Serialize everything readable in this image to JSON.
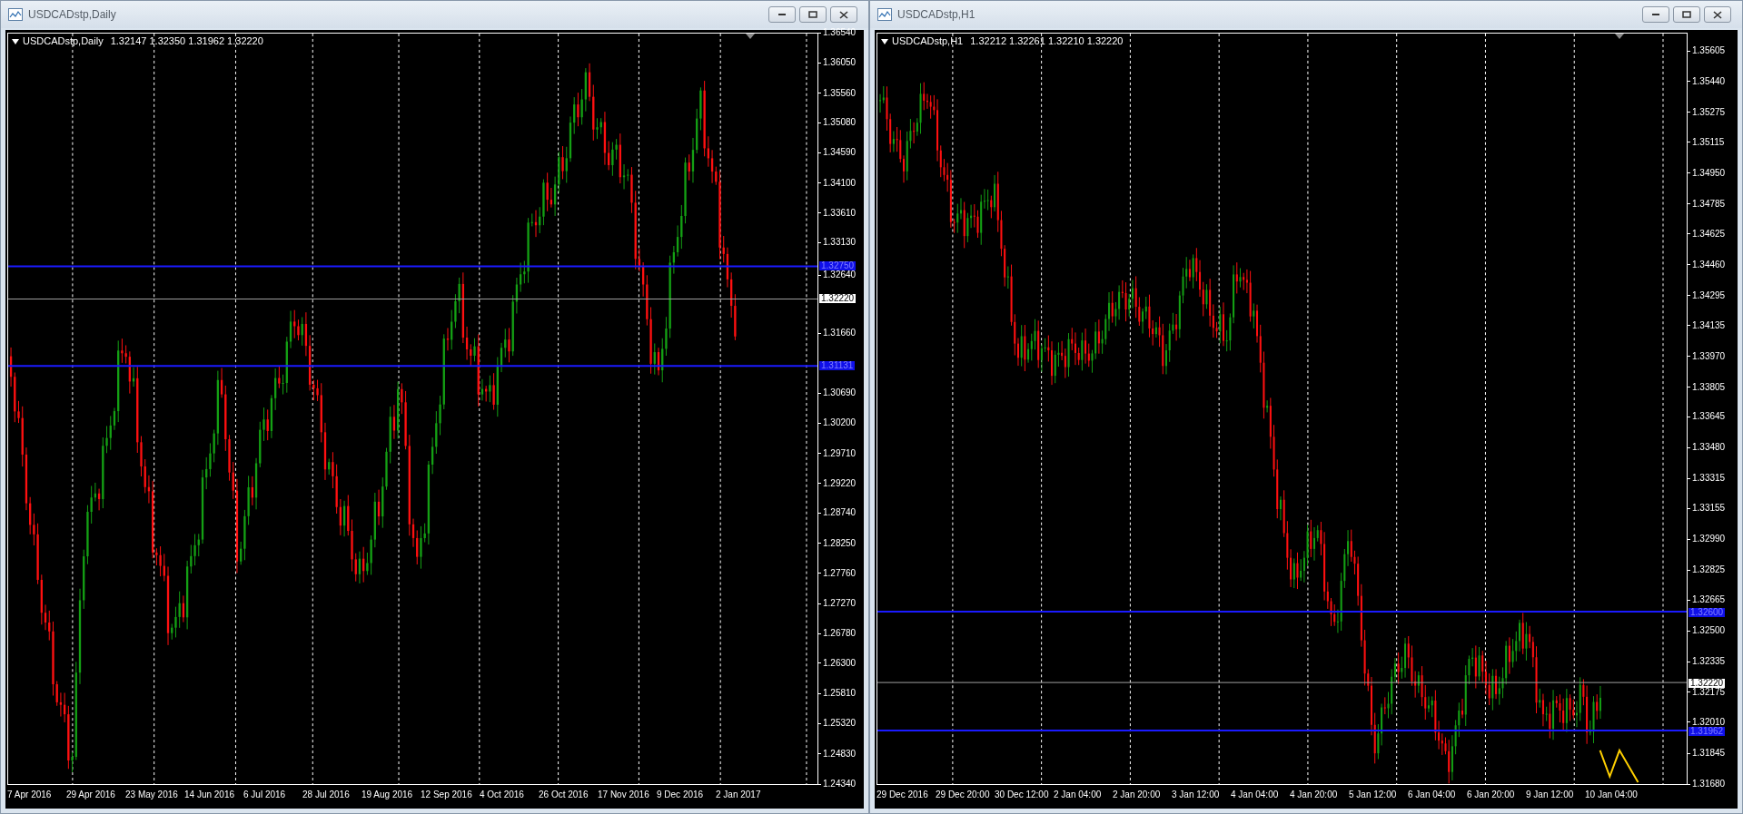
{
  "windows": [
    {
      "title": "USDCADstp,Daily",
      "chart": {
        "symbol": "USDCADstp,Daily",
        "ohlc": "1.32147 1.32350 1.31962 1.32220",
        "price_ticks": [
          "1.36540",
          "1.36050",
          "1.35560",
          "1.35080",
          "1.34590",
          "1.34100",
          "1.33610",
          "1.33130",
          "1.32640",
          "1.31660",
          "1.30690",
          "1.30200",
          "1.29710",
          "1.29220",
          "1.28740",
          "1.28250",
          "1.27760",
          "1.27270",
          "1.26780",
          "1.26300",
          "1.25810",
          "1.25320",
          "1.24830",
          "1.24340"
        ],
        "time_ticks": [
          "7 Apr 2016",
          "29 Apr 2016",
          "23 May 2016",
          "14 Jun 2016",
          "6 Jul 2016",
          "28 Jul 2016",
          "19 Aug 2016",
          "12 Sep 2016",
          "4 Oct 2016",
          "26 Oct 2016",
          "17 Nov 2016",
          "9 Dec 2016",
          "2 Jan 2017"
        ],
        "levels": [
          {
            "label": "1.32750"
          },
          {
            "label": "1.31131"
          }
        ],
        "current_price": "1.32220"
      }
    },
    {
      "title": "USDCADstp,H1",
      "chart": {
        "symbol": "USDCADstp,H1",
        "ohlc": "1.32212 1.32261 1.32210 1.32220",
        "price_ticks": [
          "1.35605",
          "1.35440",
          "1.35275",
          "1.35115",
          "1.34950",
          "1.34785",
          "1.34625",
          "1.34460",
          "1.34295",
          "1.34135",
          "1.33970",
          "1.33805",
          "1.33645",
          "1.33480",
          "1.33315",
          "1.33155",
          "1.32990",
          "1.32825",
          "1.32665",
          "1.32500",
          "1.32335",
          "1.32175",
          "1.32010",
          "1.31845",
          "1.31680"
        ],
        "time_ticks": [
          "29 Dec 2016",
          "29 Dec 20:00",
          "30 Dec 12:00",
          "2 Jan 04:00",
          "2 Jan 20:00",
          "3 Jan 12:00",
          "4 Jan 04:00",
          "4 Jan 20:00",
          "5 Jan 12:00",
          "6 Jan 04:00",
          "6 Jan 20:00",
          "9 Jan 12:00",
          "10 Jan 04:00"
        ],
        "levels": [
          {
            "label": "1.32600"
          },
          {
            "label": "1.31962"
          }
        ],
        "current_price": "1.32220"
      }
    }
  ]
}
